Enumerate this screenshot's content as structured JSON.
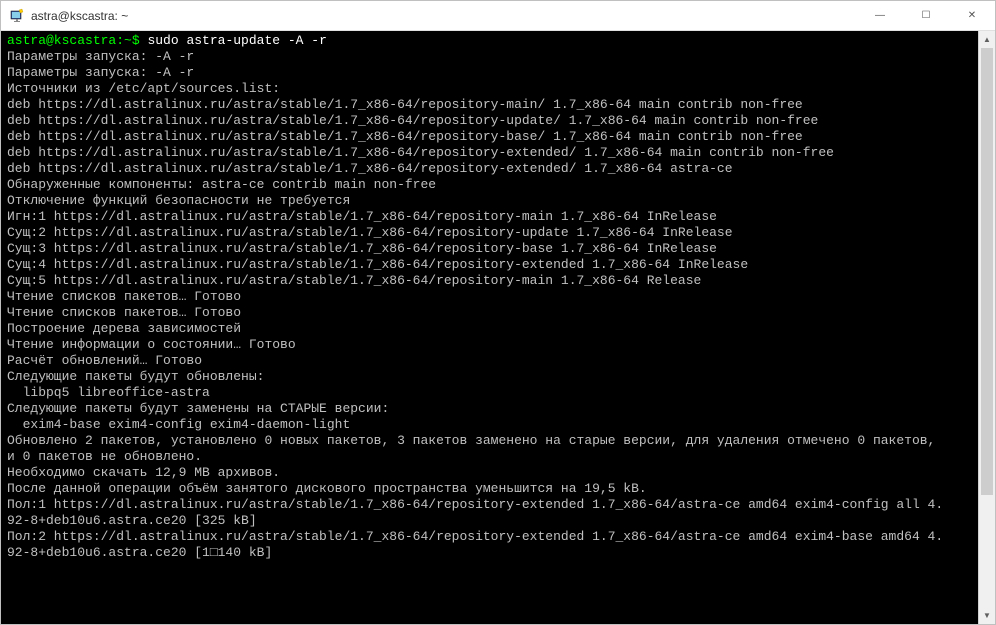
{
  "window": {
    "title": "astra@kscastra: ~",
    "icon_name": "putty-icon"
  },
  "titlebar_controls": {
    "minimize": "—",
    "maximize": "☐",
    "close": "✕"
  },
  "terminal": {
    "prompt": "astra@kscastra:~$",
    "command": "sudo astra-update -A -r",
    "lines": [
      "Параметры запуска: -A -r",
      "",
      "Параметры запуска: -A -r",
      "",
      "Источники из /etc/apt/sources.list:",
      "deb https://dl.astralinux.ru/astra/stable/1.7_x86-64/repository-main/ 1.7_x86-64 main contrib non-free",
      "deb https://dl.astralinux.ru/astra/stable/1.7_x86-64/repository-update/ 1.7_x86-64 main contrib non-free",
      "deb https://dl.astralinux.ru/astra/stable/1.7_x86-64/repository-base/ 1.7_x86-64 main contrib non-free",
      "deb https://dl.astralinux.ru/astra/stable/1.7_x86-64/repository-extended/ 1.7_x86-64 main contrib non-free",
      "deb https://dl.astralinux.ru/astra/stable/1.7_x86-64/repository-extended/ 1.7_x86-64 astra-ce",
      "",
      "Обнаруженные компоненты: astra-ce contrib main non-free",
      "Отключение функций безопасности не требуется",
      "Игн:1 https://dl.astralinux.ru/astra/stable/1.7_x86-64/repository-main 1.7_x86-64 InRelease",
      "Сущ:2 https://dl.astralinux.ru/astra/stable/1.7_x86-64/repository-update 1.7_x86-64 InRelease",
      "Сущ:3 https://dl.astralinux.ru/astra/stable/1.7_x86-64/repository-base 1.7_x86-64 InRelease",
      "Сущ:4 https://dl.astralinux.ru/astra/stable/1.7_x86-64/repository-extended 1.7_x86-64 InRelease",
      "Сущ:5 https://dl.astralinux.ru/astra/stable/1.7_x86-64/repository-main 1.7_x86-64 Release",
      "Чтение списков пакетов… Готово",
      "Чтение списков пакетов… Готово",
      "Построение дерева зависимостей",
      "Чтение информации о состоянии… Готово",
      "Расчёт обновлений… Готово",
      "Следующие пакеты будут обновлены:",
      "  libpq5 libreoffice-astra",
      "Следующие пакеты будут заменены на СТАРЫЕ версии:",
      "  exim4-base exim4-config exim4-daemon-light",
      "Обновлено 2 пакетов, установлено 0 новых пакетов, 3 пакетов заменено на старые версии, для удаления отмечено 0 пакетов,",
      "и 0 пакетов не обновлено.",
      "Необходимо скачать 12,9 MB архивов.",
      "После данной операции объём занятого дискового пространства уменьшится на 19,5 kB.",
      "Пол:1 https://dl.astralinux.ru/astra/stable/1.7_x86-64/repository-extended 1.7_x86-64/astra-ce amd64 exim4-config all 4.",
      "92-8+deb10u6.astra.ce20 [325 kB]",
      "Пол:2 https://dl.astralinux.ru/astra/stable/1.7_x86-64/repository-extended 1.7_x86-64/astra-ce amd64 exim4-base amd64 4.",
      "92-8+deb10u6.astra.ce20 [1□140 kB]"
    ]
  },
  "scrollbar": {
    "arrow_up": "▲",
    "arrow_down": "▼"
  }
}
